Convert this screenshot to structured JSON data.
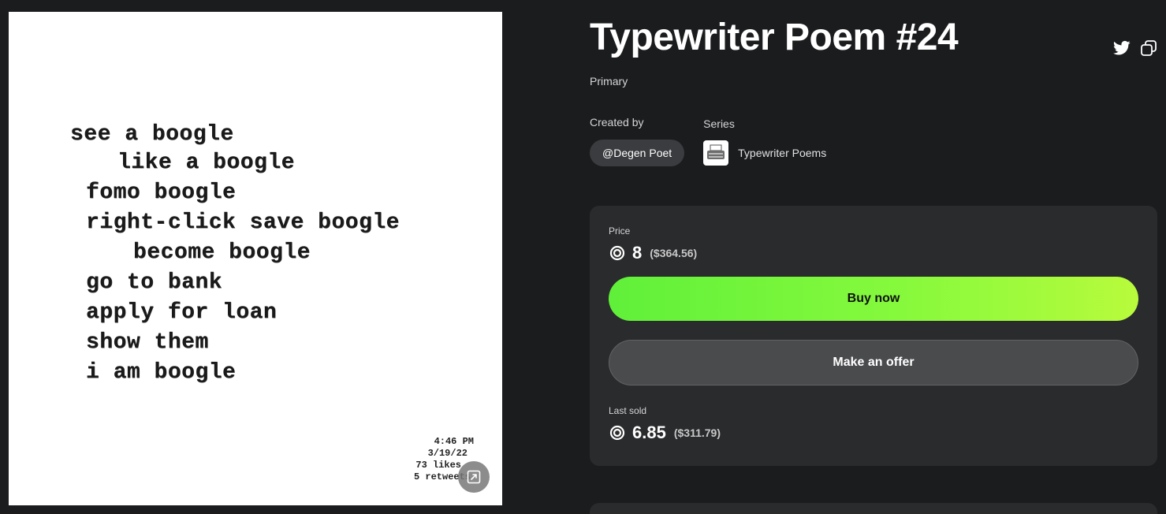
{
  "artwork": {
    "poem_lines": [
      "see a boogle",
      "like a boogle",
      "fomo boogle",
      "right-click save boogle",
      "become boogle",
      "go to bank",
      "apply for loan",
      "show them",
      "i am boogle"
    ],
    "stamp_lines": [
      "4:46 PM",
      "3/19/22",
      "73 likes",
      "5 retweets"
    ],
    "expand_icon": "expand-icon"
  },
  "details": {
    "title": "Typewriter Poem #24",
    "sale_type": "Primary",
    "share_icons": [
      "twitter-icon",
      "copy-link-icon"
    ],
    "created_by_label": "Created by",
    "creator": "@Degen Poet",
    "series_label": "Series",
    "series_name": "Typewriter Poems"
  },
  "price_card": {
    "price_label": "Price",
    "price_value": "8",
    "price_usd": "($364.56)",
    "currency_icon": "tezos-icon",
    "buy_label": "Buy now",
    "offer_label": "Make an offer",
    "last_sold_label": "Last sold",
    "last_sold_value": "6.85",
    "last_sold_usd": "($311.79)"
  },
  "colors": {
    "background": "#1b1c1e",
    "card": "#2a2b2d",
    "buy_gradient_start": "#60f03a",
    "buy_gradient_end": "#b8fb3c",
    "offer_button": "#4a4b4d"
  }
}
